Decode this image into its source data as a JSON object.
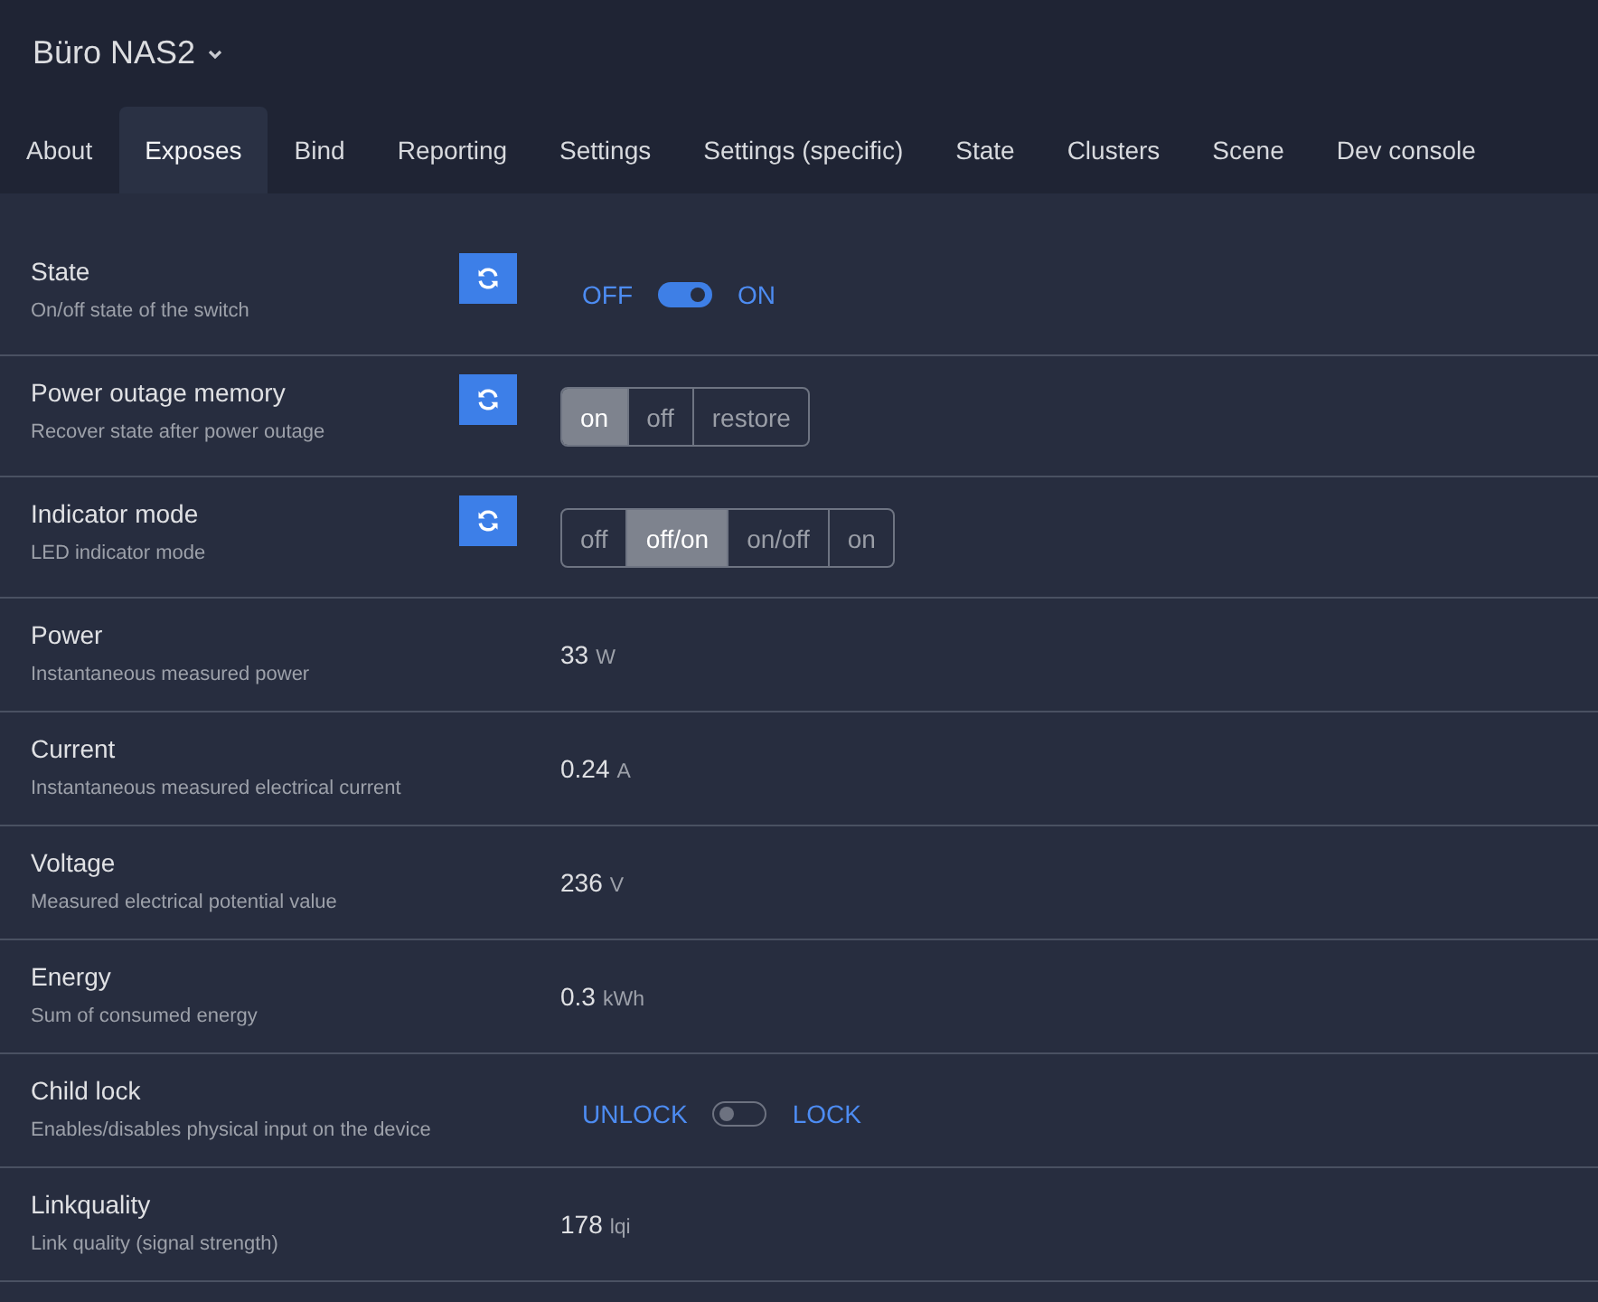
{
  "header": {
    "title": "Büro NAS2"
  },
  "tabs": [
    {
      "label": "About",
      "selected": false
    },
    {
      "label": "Exposes",
      "selected": true
    },
    {
      "label": "Bind",
      "selected": false
    },
    {
      "label": "Reporting",
      "selected": false
    },
    {
      "label": "Settings",
      "selected": false
    },
    {
      "label": "Settings (specific)",
      "selected": false
    },
    {
      "label": "State",
      "selected": false
    },
    {
      "label": "Clusters",
      "selected": false
    },
    {
      "label": "Scene",
      "selected": false
    },
    {
      "label": "Dev console",
      "selected": false
    }
  ],
  "rows": [
    {
      "kind": "toggle",
      "name": "State",
      "description": "On/off state of the switch",
      "refresh": true,
      "off_label": "OFF",
      "on_label": "ON",
      "on": true
    },
    {
      "kind": "enum",
      "name": "Power outage memory",
      "description": "Recover state after power outage",
      "refresh": true,
      "options": [
        {
          "label": "on",
          "selected": true
        },
        {
          "label": "off",
          "selected": false
        },
        {
          "label": "restore",
          "selected": false
        }
      ]
    },
    {
      "kind": "enum",
      "name": "Indicator mode",
      "description": "LED indicator mode",
      "refresh": true,
      "options": [
        {
          "label": "off",
          "selected": false
        },
        {
          "label": "off/on",
          "selected": true
        },
        {
          "label": "on/off",
          "selected": false
        },
        {
          "label": "on",
          "selected": false
        }
      ]
    },
    {
      "kind": "value",
      "name": "Power",
      "description": "Instantaneous measured power",
      "refresh": false,
      "value": "33",
      "unit": "W"
    },
    {
      "kind": "value",
      "name": "Current",
      "description": "Instantaneous measured electrical current",
      "refresh": false,
      "value": "0.24",
      "unit": "A"
    },
    {
      "kind": "value",
      "name": "Voltage",
      "description": "Measured electrical potential value",
      "refresh": false,
      "value": "236",
      "unit": "V"
    },
    {
      "kind": "value",
      "name": "Energy",
      "description": "Sum of consumed energy",
      "refresh": false,
      "value": "0.3",
      "unit": "kWh"
    },
    {
      "kind": "toggle",
      "name": "Child lock",
      "description": "Enables/disables physical input on the device",
      "refresh": false,
      "off_label": "UNLOCK",
      "on_label": "LOCK",
      "on": false
    },
    {
      "kind": "value",
      "name": "Linkquality",
      "description": "Link quality (signal strength)",
      "refresh": false,
      "value": "178",
      "unit": "lqi"
    }
  ]
}
